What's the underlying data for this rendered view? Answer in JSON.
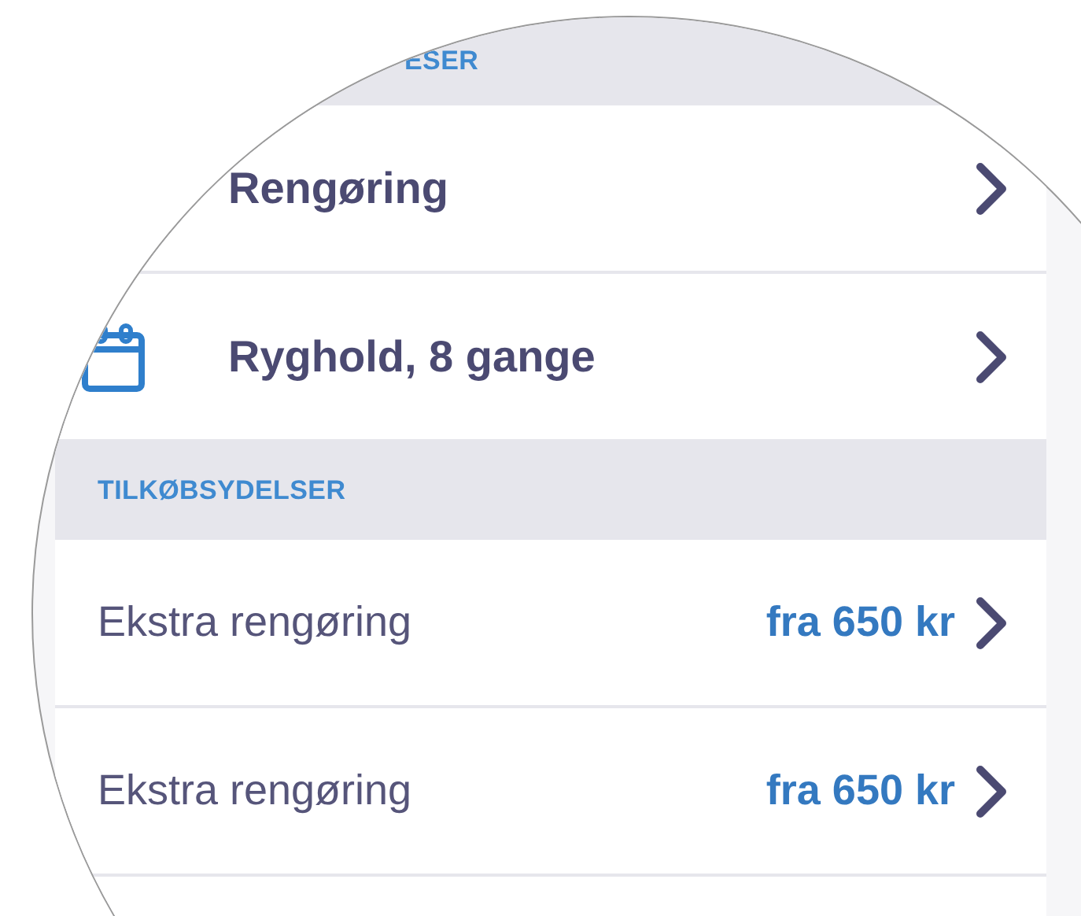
{
  "sections": [
    {
      "header": "ESER",
      "rows": [
        {
          "kind": "service",
          "title": "Rengøring"
        },
        {
          "kind": "calendar_service",
          "title": "Ryghold, 8 gange"
        }
      ]
    },
    {
      "header": "TILKØBSYDELSER",
      "rows": [
        {
          "kind": "addon",
          "title": "Ekstra rengøring",
          "price": "fra 650 kr"
        },
        {
          "kind": "addon",
          "title": "Ekstra rengøring",
          "price": "fra 650 kr"
        }
      ]
    }
  ]
}
